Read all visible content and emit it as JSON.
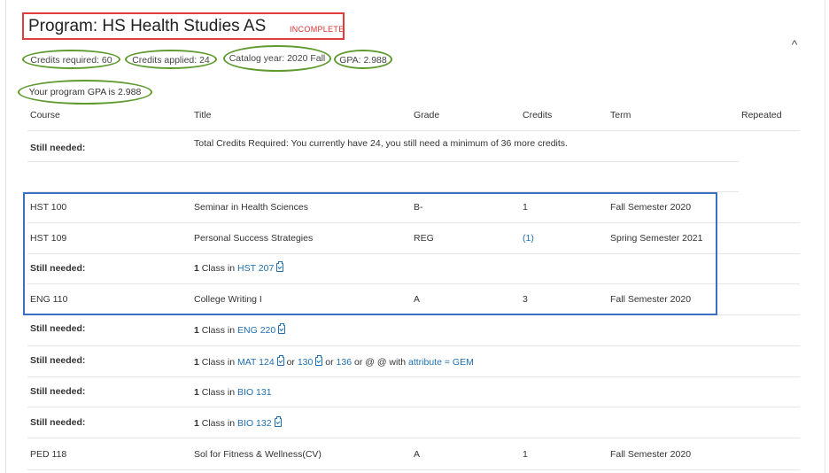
{
  "program": {
    "title": "Program: HS Health Studies AS",
    "status": "INCOMPLETE",
    "credits_required": "Credits required:  60",
    "credits_applied": "Credits applied:  24",
    "catalog_year": "Catalog year:  2020 Fall",
    "gpa": "GPA:  2.988",
    "gpa_note": "Your program GPA is 2.988",
    "collapse_symbol": "^"
  },
  "columns": {
    "course": "Course",
    "title": "Title",
    "grade": "Grade",
    "credits": "Credits",
    "term": "Term",
    "repeated": "Repeated"
  },
  "rows": {
    "r0": {
      "course": "Still needed:",
      "text": "Total Credits Required: You currently have 24, you still need a minimum of 36 more credits."
    },
    "r1": {
      "course": "HST 100",
      "title": "Seminar in Health Sciences",
      "grade": "B-",
      "credits": "1",
      "term": "Fall Semester 2020"
    },
    "r2": {
      "course": "HST 109",
      "title": "Personal Success Strategies",
      "grade": "REG",
      "credits": "(1)",
      "term": "Spring Semester 2021"
    },
    "r3": {
      "course": "Still needed:",
      "count": "1",
      "class_in": " Class in ",
      "link": "HST 207"
    },
    "r4": {
      "course": "ENG 110",
      "title": "College Writing I",
      "grade": "A",
      "credits": "3",
      "term": "Fall Semester 2020"
    },
    "r5": {
      "course": "Still needed:",
      "count": "1",
      "class_in": " Class in ",
      "link": "ENG 220"
    },
    "r6": {
      "course": "Still needed:",
      "count": "1",
      "class_in": " Class in ",
      "link1": "MAT 124",
      "or1": " or ",
      "link2": "130",
      "or2": " or ",
      "link3": "136",
      "mid": " or @ @ with ",
      "link4": "attribute = GEM"
    },
    "r7": {
      "course": "Still needed:",
      "count": "1",
      "class_in": " Class in ",
      "link": "BIO 131"
    },
    "r8": {
      "course": "Still needed:",
      "count": "1",
      "class_in": " Class in ",
      "link": "BIO 132"
    },
    "r9": {
      "course": "PED 118",
      "title": "Sol for Fitness & Wellness(CV)",
      "grade": "A",
      "credits": "1",
      "term": "Fall Semester 2020"
    }
  },
  "colors": {
    "link": "#1f6fb2",
    "status_red": "#dd3333",
    "highlight_green": "#5e9a2e",
    "highlight_blue": "#3a6fc4"
  }
}
